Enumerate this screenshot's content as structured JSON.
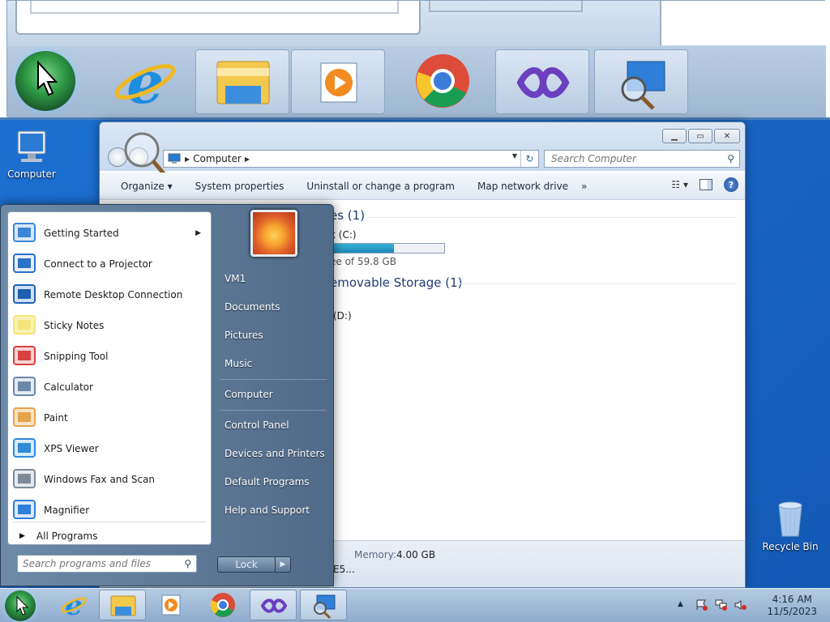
{
  "desktop": {
    "icons": [
      {
        "label": "Computer",
        "icon": "computer-icon"
      },
      {
        "label": "Recycle Bin",
        "icon": "recycle-bin-icon"
      }
    ]
  },
  "explorer": {
    "address": {
      "crumb": "Computer"
    },
    "search": {
      "placeholder": "Search Computer"
    },
    "toolbar": {
      "organize": "Organize ▾",
      "system_properties": "System properties",
      "uninstall": "Uninstall or change a program",
      "map_drive": "Map network drive",
      "more": "»"
    },
    "groups": {
      "hard_disks_head": "es (1)",
      "removable_head": "emovable Storage (1)"
    },
    "drives": {
      "c_label": "k (C:)",
      "c_free": "ee of 59.8 GB",
      "c_used_fraction": 0.56,
      "d_label": "(D:)"
    },
    "details": {
      "memory_key": "Memory:",
      "memory_value": "4.00 GB",
      "processor_value": "E5..."
    }
  },
  "start_menu": {
    "programs": [
      {
        "label": "Getting Started",
        "has_submenu": true,
        "icon": "getting-started-icon"
      },
      {
        "label": "Connect to a Projector",
        "icon": "projector-icon"
      },
      {
        "label": "Remote Desktop Connection",
        "icon": "remote-desktop-icon"
      },
      {
        "label": "Sticky Notes",
        "icon": "sticky-notes-icon"
      },
      {
        "label": "Snipping Tool",
        "icon": "snipping-tool-icon"
      },
      {
        "label": "Calculator",
        "icon": "calculator-icon"
      },
      {
        "label": "Paint",
        "icon": "paint-icon"
      },
      {
        "label": "XPS Viewer",
        "icon": "xps-viewer-icon"
      },
      {
        "label": "Windows Fax and Scan",
        "icon": "fax-scan-icon"
      },
      {
        "label": "Magnifier",
        "icon": "magnifier-icon"
      }
    ],
    "all_programs": "All Programs",
    "search_placeholder": "Search programs and files",
    "right_links": {
      "user": "VM1",
      "documents": "Documents",
      "pictures": "Pictures",
      "music": "Music",
      "computer": "Computer",
      "control_panel": "Control Panel",
      "devices": "Devices and Printers",
      "default_programs": "Default Programs",
      "help": "Help and Support"
    },
    "lock": "Lock"
  },
  "taskbar": {
    "pinned": [
      "internet-explorer-icon",
      "file-explorer-icon",
      "media-player-icon",
      "chrome-icon",
      "visual-studio-icon",
      "magnifier-icon"
    ],
    "clock": {
      "time": "4:16 AM",
      "date": "11/5/2023"
    }
  }
}
